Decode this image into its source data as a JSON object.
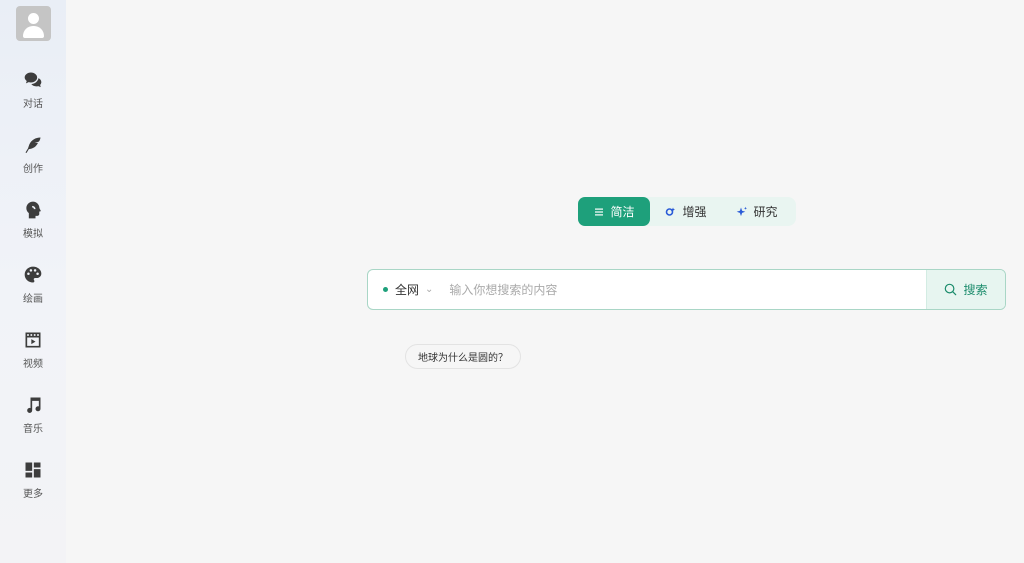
{
  "sidebar": {
    "items": [
      {
        "label": "对话",
        "icon": "chat-bubbles-icon"
      },
      {
        "label": "创作",
        "icon": "feather-icon"
      },
      {
        "label": "模拟",
        "icon": "head-profile-icon"
      },
      {
        "label": "绘画",
        "icon": "palette-icon"
      },
      {
        "label": "视频",
        "icon": "video-clapper-icon"
      },
      {
        "label": "音乐",
        "icon": "music-note-icon"
      },
      {
        "label": "更多",
        "icon": "grid-icon"
      }
    ]
  },
  "modes": {
    "concise": "简洁",
    "enhanced": "增强",
    "research": "研究"
  },
  "search": {
    "scope": "全网",
    "placeholder": "输入你想搜索的内容",
    "value": "",
    "button_label": "搜索"
  },
  "suggestions": [
    "地球为什么是圆的？"
  ],
  "colors": {
    "accent": "#1ea07b",
    "accent_light": "#e9f5f1"
  }
}
